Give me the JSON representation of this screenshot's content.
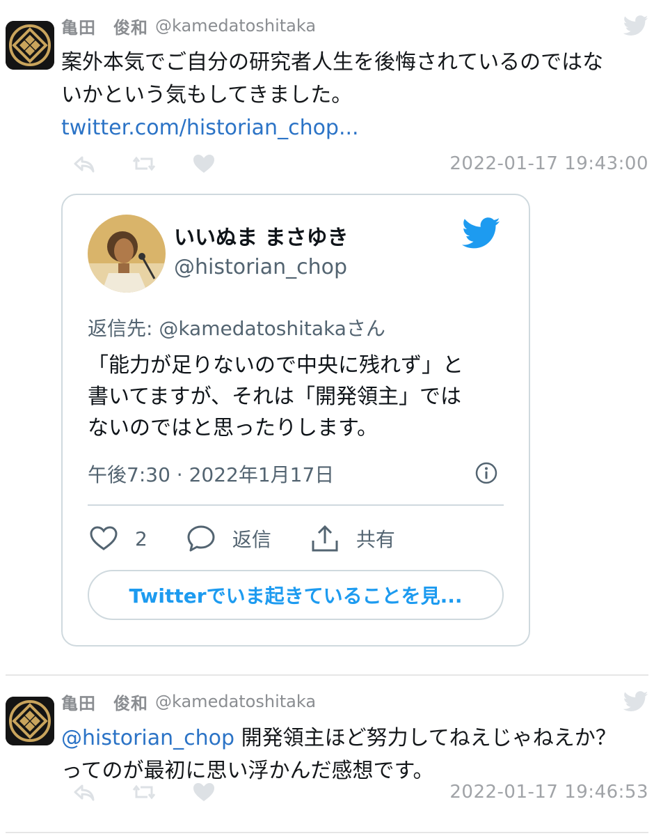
{
  "tweets": [
    {
      "author": {
        "name": "亀田　俊和",
        "handle": "@kamedatoshitaka"
      },
      "body_lines": [
        "案外本気でご自分の研究者人生を後悔されているのではな",
        "いかという気もしてきました。"
      ],
      "link_text": "twitter.com/historian_chop...",
      "timestamp": "2022-01-17 19:43:00",
      "embed": {
        "name": "いいぬま まさゆき",
        "handle": "@historian_chop",
        "reply_to": "返信先: @kamedatoshitakaさん",
        "body_lines": [
          "「能力が足りないので中央に残れず」と",
          "書いてますが、それは「開発領主」では",
          "ないのではと思ったりします。"
        ],
        "time": "午後7:30 · 2022年1月17日",
        "likes": "2",
        "reply_label": "返信",
        "share_label": "共有",
        "cta": "Twitterでいま起きていることを見..."
      }
    },
    {
      "author": {
        "name": "亀田　俊和",
        "handle": "@kamedatoshitaka"
      },
      "mention": "@historian_chop",
      "body_first_rest": " 開発領主ほど努力してねえじゃねえか？",
      "body_second": "ってのが最初に思い浮かんだ感想です。",
      "timestamp": "2022-01-17 19:46:53"
    }
  ],
  "colors": {
    "link": "#2b73c6",
    "twitter_blue": "#1d9bf0",
    "muted": "#a0a3a7"
  },
  "icons": [
    "reply-icon",
    "retweet-icon",
    "heart-icon",
    "twitter-bird-icon",
    "info-icon",
    "share-icon",
    "comment-icon"
  ]
}
